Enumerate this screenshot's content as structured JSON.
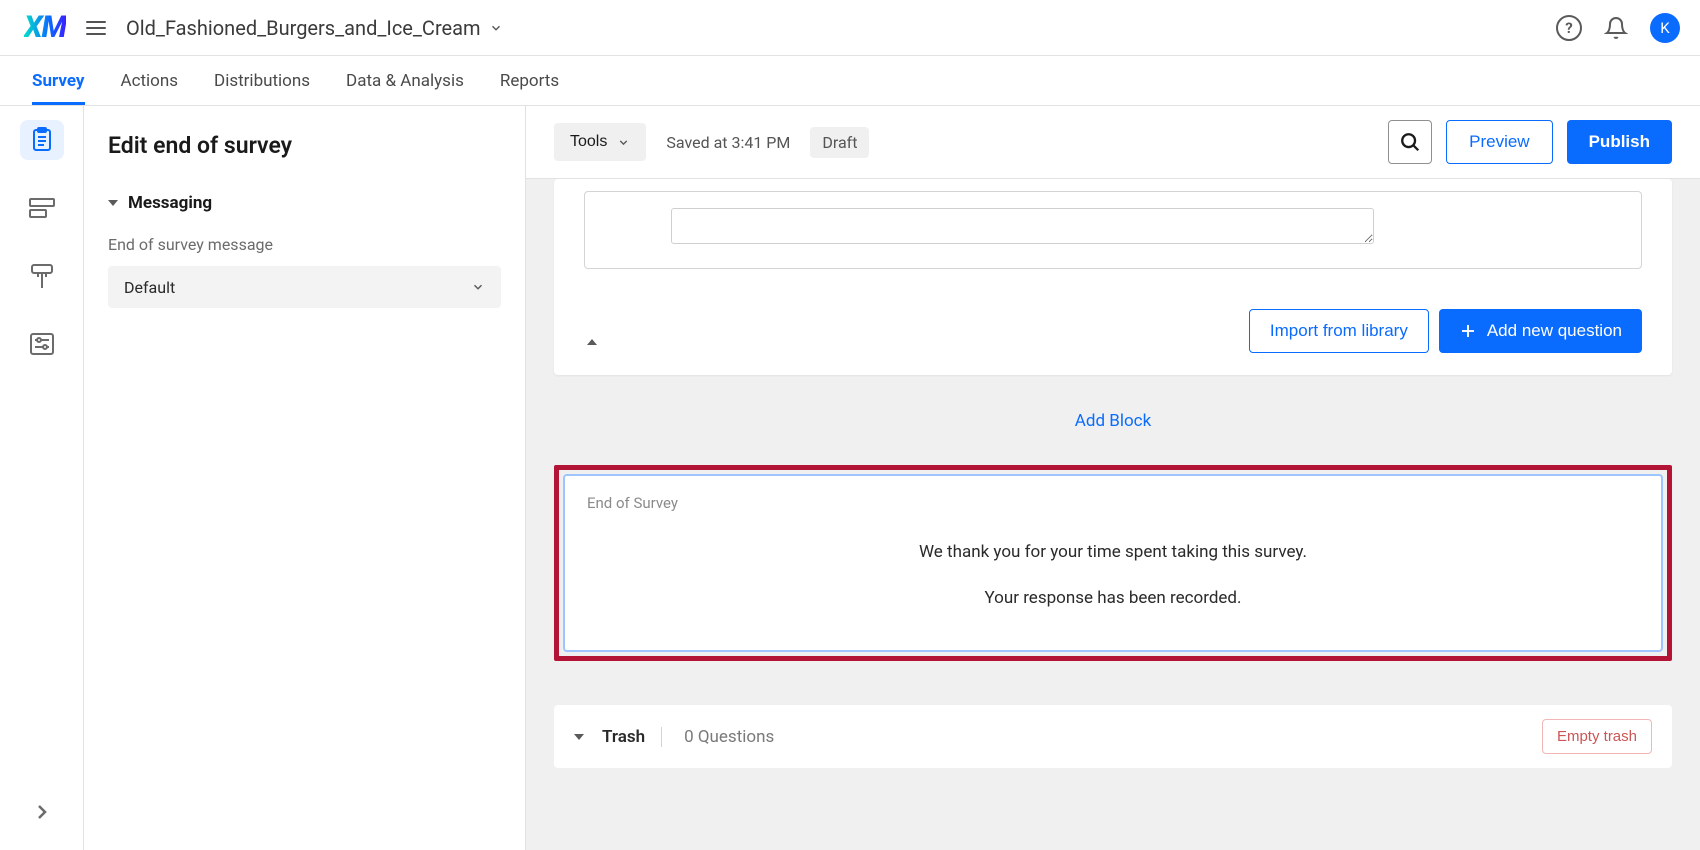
{
  "header": {
    "project_name": "Old_Fashioned_Burgers_and_Ice_Cream",
    "avatar_letter": "K"
  },
  "tabs": {
    "items": [
      "Survey",
      "Actions",
      "Distributions",
      "Data & Analysis",
      "Reports"
    ],
    "active_index": 0
  },
  "edit_panel": {
    "title": "Edit end of survey",
    "messaging_label": "Messaging",
    "field_label": "End of survey message",
    "select_value": "Default"
  },
  "toolbar": {
    "tools_label": "Tools",
    "saved_at": "Saved at 3:41 PM",
    "status_chip": "Draft",
    "preview_label": "Preview",
    "publish_label": "Publish"
  },
  "canvas": {
    "import_label": "Import from library",
    "add_question_label": "Add new question",
    "add_block_label": "Add Block",
    "eos": {
      "heading": "End of Survey",
      "line1": "We thank you for your time spent taking this survey.",
      "line2": "Your response has been recorded."
    },
    "trash": {
      "title": "Trash",
      "count_text": "0 Questions",
      "empty_label": "Empty trash"
    }
  },
  "colors": {
    "primary": "#0a6bff",
    "highlight": "#b31334"
  }
}
